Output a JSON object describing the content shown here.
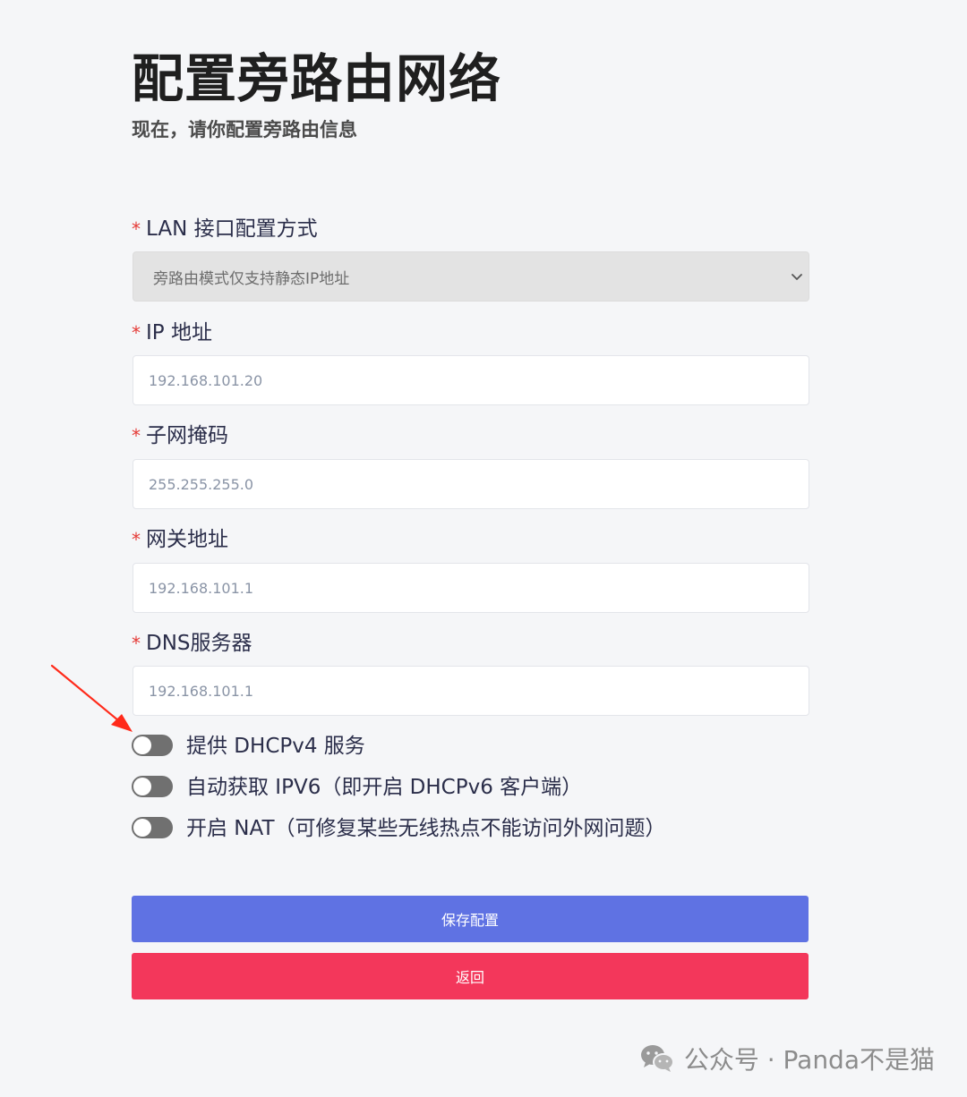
{
  "header": {
    "title": "配置旁路由网络",
    "subtitle": "现在，请你配置旁路由信息"
  },
  "form": {
    "required_mark": "*",
    "lan_mode": {
      "label": "LAN 接口配置方式",
      "selected": "旁路由模式仅支持静态IP地址"
    },
    "ip": {
      "label": "IP 地址",
      "placeholder": "192.168.101.20"
    },
    "netmask": {
      "label": "子网掩码",
      "placeholder": "255.255.255.0"
    },
    "gateway": {
      "label": "网关地址",
      "placeholder": "192.168.101.1"
    },
    "dns": {
      "label": "DNS服务器",
      "placeholder": "192.168.101.1"
    },
    "toggles": [
      {
        "label": "提供 DHCPv4 服务",
        "on": false
      },
      {
        "label": "自动获取 IPV6（即开启 DHCPv6 客户端）",
        "on": false
      },
      {
        "label": "开启 NAT（可修复某些无线热点不能访问外网问题）",
        "on": false
      }
    ]
  },
  "actions": {
    "save_label": "保存配置",
    "back_label": "返回"
  },
  "watermark": {
    "text": "公众号 · Panda不是猫"
  },
  "colors": {
    "save": "#5f72e3",
    "back": "#f3375b",
    "required": "#e53935",
    "annotation_arrow": "#ff2a1a"
  }
}
